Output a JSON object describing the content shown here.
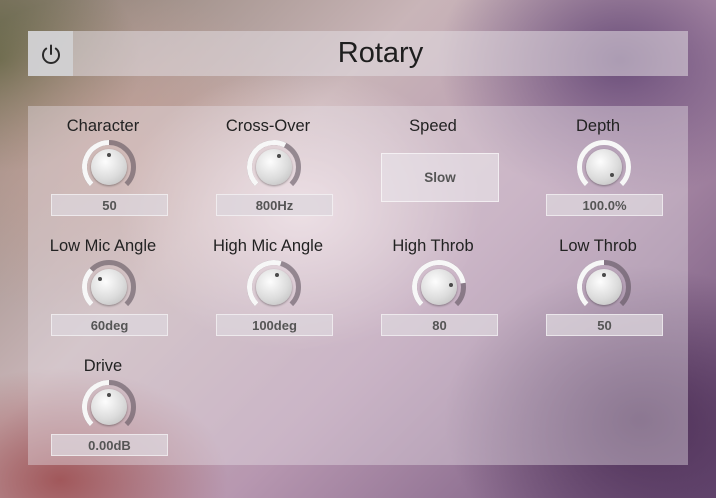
{
  "header": {
    "title": "Rotary",
    "power_icon": "power-icon"
  },
  "controls": {
    "character": {
      "label": "Character",
      "value": "50",
      "level": 0.5
    },
    "crossover": {
      "label": "Cross-Over",
      "value": "800Hz",
      "level": 0.6
    },
    "speed": {
      "label": "Speed",
      "value": "Slow"
    },
    "depth": {
      "label": "Depth",
      "value": "100.0%",
      "level": 1.0
    },
    "low_mic": {
      "label": "Low Mic Angle",
      "value": "60deg",
      "level": 0.33
    },
    "high_mic": {
      "label": "High Mic Angle",
      "value": "100deg",
      "level": 0.56
    },
    "high_throb": {
      "label": "High Throb",
      "value": "80",
      "level": 0.8
    },
    "low_throb": {
      "label": "Low Throb",
      "value": "50",
      "level": 0.5
    },
    "drive": {
      "label": "Drive",
      "value": "0.00dB",
      "level": 0.5
    }
  }
}
